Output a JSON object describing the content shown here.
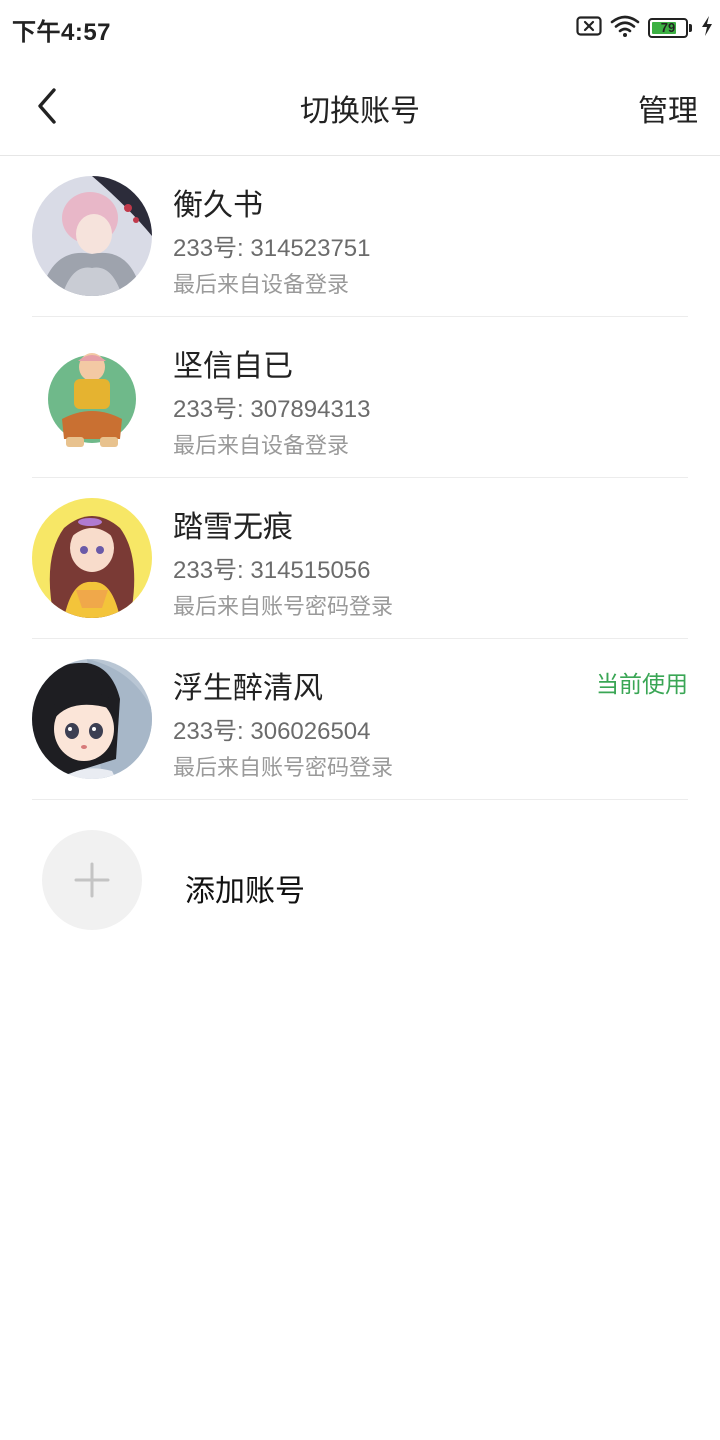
{
  "status_bar": {
    "time": "下午4:57",
    "battery_level": "79",
    "battery_percent": 79,
    "icons": [
      "sim-x-icon",
      "wifi-icon",
      "battery-icon",
      "charging-bolt-icon"
    ]
  },
  "header": {
    "title": "切换账号",
    "manage_label": "管理",
    "back_icon": "chevron-left-icon"
  },
  "accounts": [
    {
      "name": "衡久书",
      "id": "233号: 314523751",
      "login": "最后来自设备登录",
      "current": ""
    },
    {
      "name": "坚信自已",
      "id": "233号: 307894313",
      "login": "最后来自设备登录",
      "current": ""
    },
    {
      "name": "踏雪无痕",
      "id": "233号: 314515056",
      "login": "最后来自账号密码登录",
      "current": ""
    },
    {
      "name": "浮生醉清风",
      "id": "233号: 306026504",
      "login": "最后来自账号密码登录",
      "current": "当前使用"
    }
  ],
  "add_account": {
    "label": "添加账号",
    "icon": "plus-icon"
  },
  "colors": {
    "accent_green": "#3aa655",
    "battery_green": "#3cb043",
    "divider": "#ececec",
    "secondary_text": "#6b6b6b",
    "tertiary_text": "#9a9a9a"
  }
}
